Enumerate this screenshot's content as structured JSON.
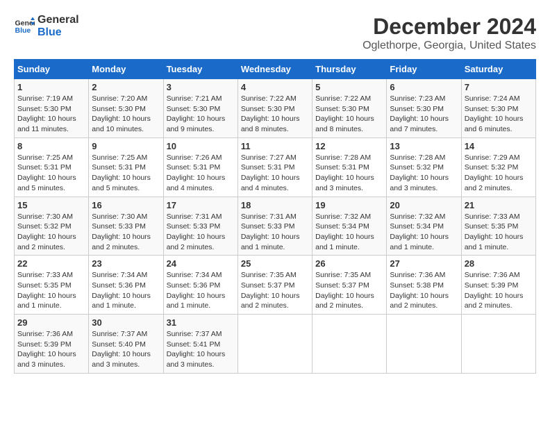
{
  "logo": {
    "line1": "General",
    "line2": "Blue"
  },
  "title": "December 2024",
  "subtitle": "Oglethorpe, Georgia, United States",
  "headers": [
    "Sunday",
    "Monday",
    "Tuesday",
    "Wednesday",
    "Thursday",
    "Friday",
    "Saturday"
  ],
  "weeks": [
    [
      {
        "day": "1",
        "sunrise": "7:19 AM",
        "sunset": "5:30 PM",
        "daylight": "10 hours and 11 minutes."
      },
      {
        "day": "2",
        "sunrise": "7:20 AM",
        "sunset": "5:30 PM",
        "daylight": "10 hours and 10 minutes."
      },
      {
        "day": "3",
        "sunrise": "7:21 AM",
        "sunset": "5:30 PM",
        "daylight": "10 hours and 9 minutes."
      },
      {
        "day": "4",
        "sunrise": "7:22 AM",
        "sunset": "5:30 PM",
        "daylight": "10 hours and 8 minutes."
      },
      {
        "day": "5",
        "sunrise": "7:22 AM",
        "sunset": "5:30 PM",
        "daylight": "10 hours and 8 minutes."
      },
      {
        "day": "6",
        "sunrise": "7:23 AM",
        "sunset": "5:30 PM",
        "daylight": "10 hours and 7 minutes."
      },
      {
        "day": "7",
        "sunrise": "7:24 AM",
        "sunset": "5:30 PM",
        "daylight": "10 hours and 6 minutes."
      }
    ],
    [
      {
        "day": "8",
        "sunrise": "7:25 AM",
        "sunset": "5:31 PM",
        "daylight": "10 hours and 5 minutes."
      },
      {
        "day": "9",
        "sunrise": "7:25 AM",
        "sunset": "5:31 PM",
        "daylight": "10 hours and 5 minutes."
      },
      {
        "day": "10",
        "sunrise": "7:26 AM",
        "sunset": "5:31 PM",
        "daylight": "10 hours and 4 minutes."
      },
      {
        "day": "11",
        "sunrise": "7:27 AM",
        "sunset": "5:31 PM",
        "daylight": "10 hours and 4 minutes."
      },
      {
        "day": "12",
        "sunrise": "7:28 AM",
        "sunset": "5:31 PM",
        "daylight": "10 hours and 3 minutes."
      },
      {
        "day": "13",
        "sunrise": "7:28 AM",
        "sunset": "5:32 PM",
        "daylight": "10 hours and 3 minutes."
      },
      {
        "day": "14",
        "sunrise": "7:29 AM",
        "sunset": "5:32 PM",
        "daylight": "10 hours and 2 minutes."
      }
    ],
    [
      {
        "day": "15",
        "sunrise": "7:30 AM",
        "sunset": "5:32 PM",
        "daylight": "10 hours and 2 minutes."
      },
      {
        "day": "16",
        "sunrise": "7:30 AM",
        "sunset": "5:33 PM",
        "daylight": "10 hours and 2 minutes."
      },
      {
        "day": "17",
        "sunrise": "7:31 AM",
        "sunset": "5:33 PM",
        "daylight": "10 hours and 2 minutes."
      },
      {
        "day": "18",
        "sunrise": "7:31 AM",
        "sunset": "5:33 PM",
        "daylight": "10 hours and 1 minute."
      },
      {
        "day": "19",
        "sunrise": "7:32 AM",
        "sunset": "5:34 PM",
        "daylight": "10 hours and 1 minute."
      },
      {
        "day": "20",
        "sunrise": "7:32 AM",
        "sunset": "5:34 PM",
        "daylight": "10 hours and 1 minute."
      },
      {
        "day": "21",
        "sunrise": "7:33 AM",
        "sunset": "5:35 PM",
        "daylight": "10 hours and 1 minute."
      }
    ],
    [
      {
        "day": "22",
        "sunrise": "7:33 AM",
        "sunset": "5:35 PM",
        "daylight": "10 hours and 1 minute."
      },
      {
        "day": "23",
        "sunrise": "7:34 AM",
        "sunset": "5:36 PM",
        "daylight": "10 hours and 1 minute."
      },
      {
        "day": "24",
        "sunrise": "7:34 AM",
        "sunset": "5:36 PM",
        "daylight": "10 hours and 1 minute."
      },
      {
        "day": "25",
        "sunrise": "7:35 AM",
        "sunset": "5:37 PM",
        "daylight": "10 hours and 2 minutes."
      },
      {
        "day": "26",
        "sunrise": "7:35 AM",
        "sunset": "5:37 PM",
        "daylight": "10 hours and 2 minutes."
      },
      {
        "day": "27",
        "sunrise": "7:36 AM",
        "sunset": "5:38 PM",
        "daylight": "10 hours and 2 minutes."
      },
      {
        "day": "28",
        "sunrise": "7:36 AM",
        "sunset": "5:39 PM",
        "daylight": "10 hours and 2 minutes."
      }
    ],
    [
      {
        "day": "29",
        "sunrise": "7:36 AM",
        "sunset": "5:39 PM",
        "daylight": "10 hours and 3 minutes."
      },
      {
        "day": "30",
        "sunrise": "7:37 AM",
        "sunset": "5:40 PM",
        "daylight": "10 hours and 3 minutes."
      },
      {
        "day": "31",
        "sunrise": "7:37 AM",
        "sunset": "5:41 PM",
        "daylight": "10 hours and 3 minutes."
      },
      null,
      null,
      null,
      null
    ]
  ],
  "labels": {
    "sunrise": "Sunrise:",
    "sunset": "Sunset:",
    "daylight": "Daylight:"
  }
}
